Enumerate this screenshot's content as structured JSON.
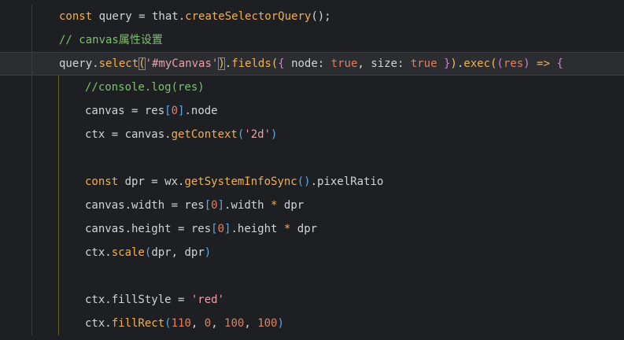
{
  "editor": {
    "fold_icon": "chevron-down-icon",
    "colors": {
      "background": "#1e1f22",
      "active_line": "#2b2d30",
      "keyword": "#f0b050",
      "string": "#e8a0a8",
      "number": "#e08060",
      "comment": "#7fbf6f",
      "text": "#d4d4d4"
    },
    "lines": [
      {
        "indent": 0,
        "tokens": [
          {
            "t": "const ",
            "c": "kw"
          },
          {
            "t": "query = that.",
            "c": "plain"
          },
          {
            "t": "createSelectorQuery",
            "c": "fn"
          },
          {
            "t": "();",
            "c": "plain"
          }
        ]
      },
      {
        "indent": 0,
        "tokens": [
          {
            "t": "// canvas属性设置",
            "c": "cmt"
          }
        ]
      },
      {
        "indent": 0,
        "active": true,
        "tokens": [
          {
            "t": "query.",
            "c": "plain"
          },
          {
            "t": "select",
            "c": "fn"
          },
          {
            "t": "(",
            "c": "br1",
            "box": true
          },
          {
            "t": "'#myCanvas'",
            "c": "str"
          },
          {
            "t": ")",
            "c": "br1",
            "box": true
          },
          {
            "t": ".",
            "c": "plain"
          },
          {
            "t": "fields",
            "c": "fn"
          },
          {
            "t": "(",
            "c": "br1"
          },
          {
            "t": "{",
            "c": "br2"
          },
          {
            "t": " node: ",
            "c": "plain"
          },
          {
            "t": "true",
            "c": "bool"
          },
          {
            "t": ", size: ",
            "c": "plain"
          },
          {
            "t": "true",
            "c": "bool"
          },
          {
            "t": " }",
            "c": "br2"
          },
          {
            "t": ")",
            "c": "br1"
          },
          {
            "t": ".",
            "c": "plain"
          },
          {
            "t": "exec",
            "c": "fn"
          },
          {
            "t": "(",
            "c": "br1"
          },
          {
            "t": "(",
            "c": "br2"
          },
          {
            "t": "res",
            "c": "num"
          },
          {
            "t": ")",
            "c": "br2"
          },
          {
            "t": " => ",
            "c": "kw"
          },
          {
            "t": "{",
            "c": "br2"
          }
        ]
      },
      {
        "indent": 1,
        "tokens": [
          {
            "t": "//console.log(res)",
            "c": "cmt"
          }
        ]
      },
      {
        "indent": 1,
        "tokens": [
          {
            "t": "canvas = res",
            "c": "plain"
          },
          {
            "t": "[",
            "c": "br3"
          },
          {
            "t": "0",
            "c": "num"
          },
          {
            "t": "]",
            "c": "br3"
          },
          {
            "t": ".node",
            "c": "plain"
          }
        ]
      },
      {
        "indent": 1,
        "tokens": [
          {
            "t": "ctx = canvas.",
            "c": "plain"
          },
          {
            "t": "getContext",
            "c": "fn"
          },
          {
            "t": "(",
            "c": "br3"
          },
          {
            "t": "'2d'",
            "c": "str"
          },
          {
            "t": ")",
            "c": "br3"
          }
        ]
      },
      {
        "indent": 1,
        "tokens": []
      },
      {
        "indent": 1,
        "tokens": [
          {
            "t": "const ",
            "c": "kw"
          },
          {
            "t": "dpr = wx.",
            "c": "plain"
          },
          {
            "t": "getSystemInfoSync",
            "c": "fn"
          },
          {
            "t": "()",
            "c": "br3"
          },
          {
            "t": ".pixelRatio",
            "c": "plain"
          }
        ]
      },
      {
        "indent": 1,
        "tokens": [
          {
            "t": "canvas.width = res",
            "c": "plain"
          },
          {
            "t": "[",
            "c": "br3"
          },
          {
            "t": "0",
            "c": "num"
          },
          {
            "t": "]",
            "c": "br3"
          },
          {
            "t": ".width ",
            "c": "plain"
          },
          {
            "t": "*",
            "c": "kw"
          },
          {
            "t": " dpr",
            "c": "plain"
          }
        ]
      },
      {
        "indent": 1,
        "tokens": [
          {
            "t": "canvas.height = res",
            "c": "plain"
          },
          {
            "t": "[",
            "c": "br3"
          },
          {
            "t": "0",
            "c": "num"
          },
          {
            "t": "]",
            "c": "br3"
          },
          {
            "t": ".height ",
            "c": "plain"
          },
          {
            "t": "*",
            "c": "kw"
          },
          {
            "t": " dpr",
            "c": "plain"
          }
        ]
      },
      {
        "indent": 1,
        "tokens": [
          {
            "t": "ctx.",
            "c": "plain"
          },
          {
            "t": "scale",
            "c": "fn"
          },
          {
            "t": "(",
            "c": "br3"
          },
          {
            "t": "dpr, dpr",
            "c": "plain"
          },
          {
            "t": ")",
            "c": "br3"
          }
        ]
      },
      {
        "indent": 1,
        "tokens": []
      },
      {
        "indent": 1,
        "tokens": [
          {
            "t": "ctx.fillStyle = ",
            "c": "plain"
          },
          {
            "t": "'red'",
            "c": "str"
          }
        ]
      },
      {
        "indent": 1,
        "tokens": [
          {
            "t": "ctx.",
            "c": "plain"
          },
          {
            "t": "fillRect",
            "c": "fn"
          },
          {
            "t": "(",
            "c": "br3"
          },
          {
            "t": "110",
            "c": "num"
          },
          {
            "t": ", ",
            "c": "plain"
          },
          {
            "t": "0",
            "c": "num"
          },
          {
            "t": ", ",
            "c": "plain"
          },
          {
            "t": "100",
            "c": "num"
          },
          {
            "t": ", ",
            "c": "plain"
          },
          {
            "t": "100",
            "c": "num"
          },
          {
            "t": ")",
            "c": "br3"
          }
        ]
      }
    ]
  }
}
